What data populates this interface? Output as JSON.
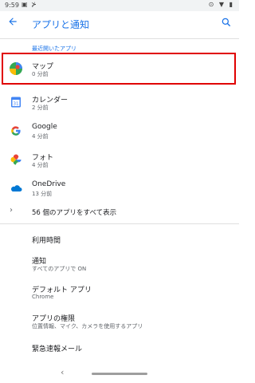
{
  "status": {
    "time": "9:59",
    "left_icons": "▣ ⊁",
    "right_icons": "⊙ ▼ ▮"
  },
  "header": {
    "title": "アプリと通知",
    "back_icon": "arrow-back-icon",
    "search_icon": "search-icon"
  },
  "recent": {
    "title": "最近開いたアプリ",
    "items": [
      {
        "label": "マップ",
        "sub": "0 分前",
        "icon": "maps-icon"
      },
      {
        "label": "カレンダー",
        "sub": "2 分前",
        "icon": "calendar-icon",
        "icon_text": "31"
      },
      {
        "label": "Google",
        "sub": "4 分前",
        "icon": "google-icon"
      },
      {
        "label": "フォト",
        "sub": "4 分前",
        "icon": "photos-icon"
      },
      {
        "label": "OneDrive",
        "sub": "13 分前",
        "icon": "onedrive-icon"
      }
    ]
  },
  "show_all": {
    "label": "56 個のアプリをすべて表示"
  },
  "settings": [
    {
      "label": "利用時間",
      "sub": ""
    },
    {
      "label": "通知",
      "sub": "すべてのアプリで ON"
    },
    {
      "label": "デフォルト アプリ",
      "sub": "Chrome"
    },
    {
      "label": "アプリの権限",
      "sub": "位置情報、マイク、カメラを使用するアプリ"
    },
    {
      "label": "緊急速報メール",
      "sub": ""
    }
  ],
  "nav": {
    "back": "‹"
  },
  "colors": {
    "accent": "#1a73e8",
    "highlight": "#e00000"
  }
}
